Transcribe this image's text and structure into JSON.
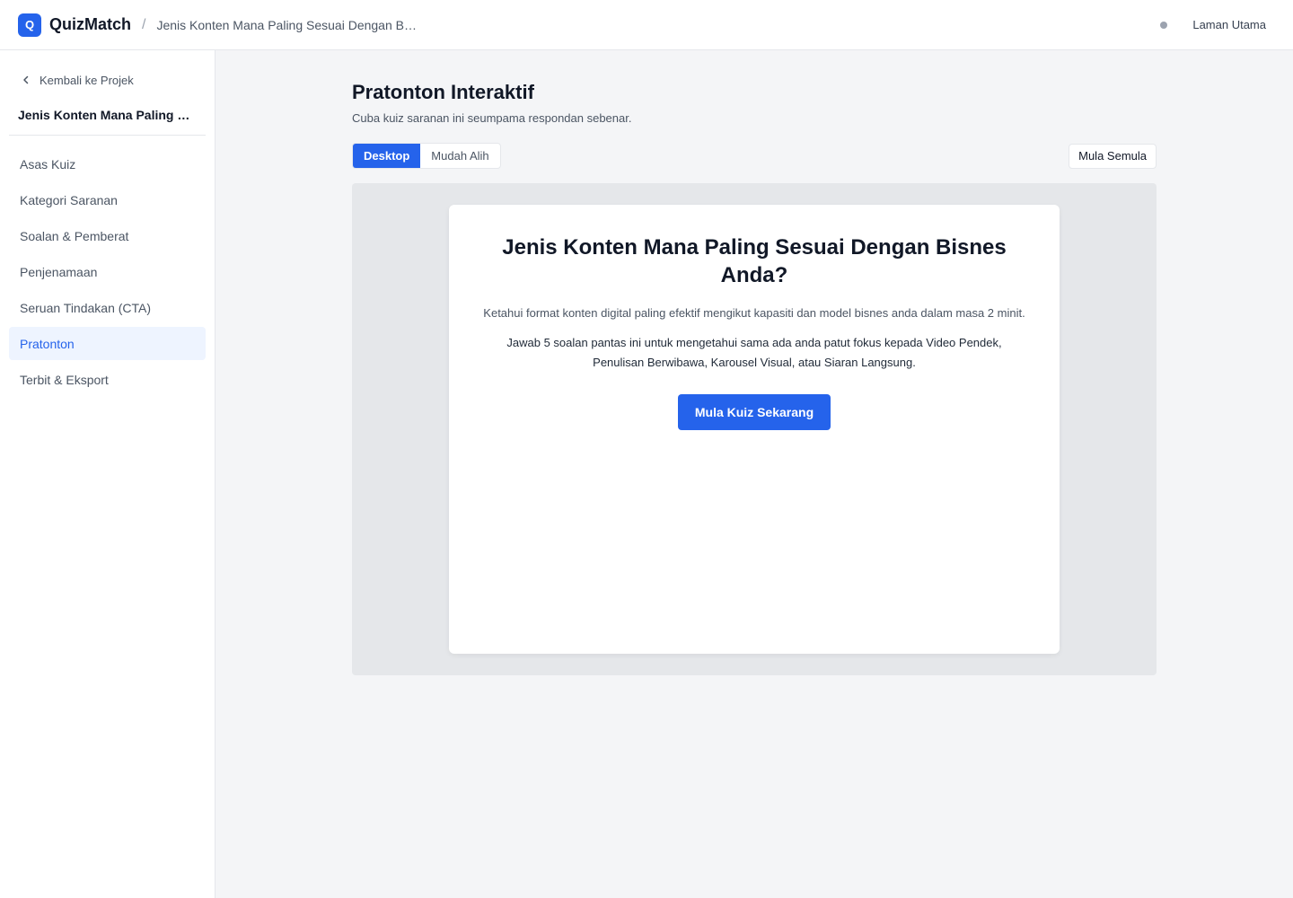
{
  "app": {
    "logo_letter": "Q",
    "brand": "QuizMatch",
    "breadcrumb_separator": "/",
    "breadcrumb": "Jenis Konten Mana Paling Sesuai Dengan Bisnes Anda?",
    "home_link": "Laman Utama"
  },
  "sidebar": {
    "back_label": "Kembali ke Projek",
    "project_name": "Jenis Konten Mana Paling Sesuai Dengan Bisnes Anda?",
    "items": [
      {
        "label": "Asas Kuiz"
      },
      {
        "label": "Kategori Saranan"
      },
      {
        "label": "Soalan & Pemberat"
      },
      {
        "label": "Penjenamaan"
      },
      {
        "label": "Seruan Tindakan (CTA)"
      },
      {
        "label": "Pratonton"
      },
      {
        "label": "Terbit & Eksport"
      }
    ],
    "active_index": 5
  },
  "main": {
    "title": "Pratonton Interaktif",
    "subtitle": "Cuba kuiz saranan ini seumpama respondan sebenar.",
    "view_tabs": [
      {
        "label": "Desktop"
      },
      {
        "label": "Mudah Alih"
      }
    ],
    "active_view": 0,
    "reset_label": "Mula Semula"
  },
  "quiz": {
    "title": "Jenis Konten Mana Paling Sesuai Dengan Bisnes Anda?",
    "description": "Ketahui format konten digital paling efektif mengikut kapasiti dan model bisnes anda dalam masa 2 minit.",
    "intro": "Jawab 5 soalan pantas ini untuk mengetahui sama ada anda patut fokus kepada Video Pendek, Penulisan Berwibawa, Karousel Visual, atau Siaran Langsung.",
    "start_label": "Mula Kuiz Sekarang"
  },
  "colors": {
    "accent": "#2563eb",
    "active_nav_bg": "#eef4ff",
    "page_bg": "#f4f5f7"
  }
}
